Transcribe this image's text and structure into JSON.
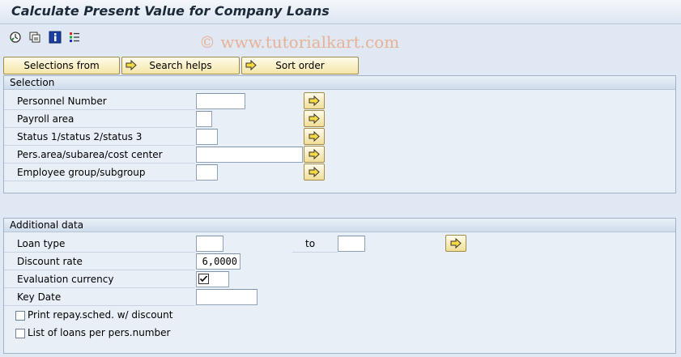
{
  "window": {
    "title": "Calculate Present Value for Company Loans"
  },
  "watermark": "© www.tutorialkart.com",
  "toolbar": {
    "icons": [
      "execute-icon",
      "get-variant-icon",
      "program-info-icon",
      "selection-options-icon"
    ]
  },
  "buttons": {
    "selections_from": "Selections from",
    "search_helps": "Search helps",
    "sort_order": "Sort order"
  },
  "selection": {
    "title": "Selection",
    "rows": [
      {
        "label": "Personnel Number",
        "value": ""
      },
      {
        "label": "Payroll area",
        "value": ""
      },
      {
        "label": "Status 1/status 2/status 3",
        "value": ""
      },
      {
        "label": "Pers.area/subarea/cost center",
        "value": ""
      },
      {
        "label": "Employee group/subgroup",
        "value": ""
      }
    ]
  },
  "additional": {
    "title": "Additional data",
    "loan_type": {
      "label": "Loan type",
      "from": "",
      "to_label": "to",
      "to": ""
    },
    "discount_rate": {
      "label": "Discount rate",
      "value": "6,0000"
    },
    "evaluation_currency": {
      "label": "Evaluation currency",
      "checked": true
    },
    "key_date": {
      "label": "Key Date",
      "value": ""
    },
    "print_repay": {
      "label": "Print repay.sched. w/ discount",
      "checked": false
    },
    "list_loans": {
      "label": "List of loans per pers.number",
      "checked": false
    }
  },
  "colors": {
    "background": "#dfe8f3",
    "button_yellow": "#f5e6a8",
    "frame_border": "#9fb3c8"
  }
}
